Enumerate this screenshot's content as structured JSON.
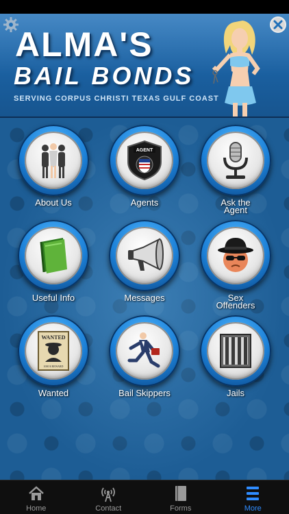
{
  "header": {
    "title_line1": "ALMA'S",
    "title_line2": "BAIL BONDS",
    "tagline": "SERVING CORPUS CHRISTI TEXAS GULF COAST"
  },
  "menu": {
    "about_us": "About Us",
    "agents": "Agents",
    "ask_agent_line1": "Ask the",
    "ask_agent_line2": "Agent",
    "useful_info": "Useful Info",
    "messages": "Messages",
    "sex_offenders_line1": "Sex",
    "sex_offenders_line2": "Offenders",
    "wanted": "Wanted",
    "bail_skippers": "Bail Skippers",
    "jails": "Jails",
    "agent_badge_text": "AGENT",
    "wanted_poster_title": "WANTED",
    "wanted_poster_reward": "1000 $ REWARD"
  },
  "tabbar": {
    "home": "Home",
    "contact": "Contact",
    "forms": "Forms",
    "more": "More",
    "active": "more"
  },
  "colors": {
    "accent": "#2f8cff",
    "header_blue": "#1e6fb8",
    "background_blue": "#1d5d95"
  }
}
